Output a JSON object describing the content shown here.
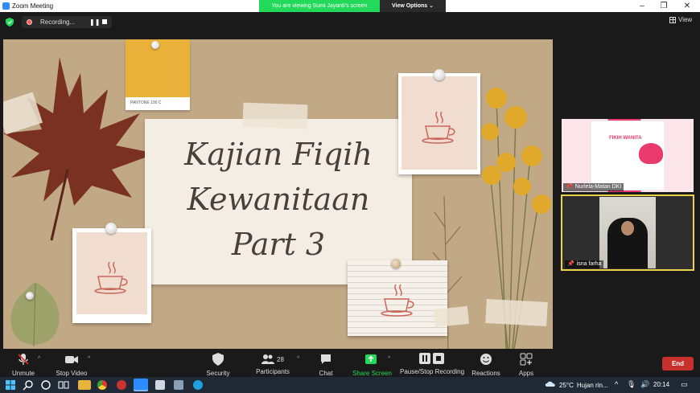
{
  "window": {
    "title": "Zoom Meeting"
  },
  "banner": {
    "message": "You are viewing Sumi Jayanti's screen",
    "options_label": "View Options"
  },
  "recording": {
    "label": "Recording..."
  },
  "view_button": {
    "label": "View"
  },
  "slide": {
    "title_line1": "Kajian Fiqih",
    "title_line2": "Kewanitaan",
    "title_line3": "Part 3",
    "pantone_label": "PANTONE 100 C"
  },
  "participants_tiles": [
    {
      "name": "Nurlela-Matan DKI",
      "poster_title": "FIKIH WANITA"
    },
    {
      "name": "isna farha"
    }
  ],
  "controls": {
    "unmute": "Unmute",
    "stop_video": "Stop Video",
    "security": "Security",
    "participants": "Participants",
    "participants_count": "28",
    "chat": "Chat",
    "share_screen": "Share Screen",
    "pause_stop_recording": "Pause/Stop Recording",
    "reactions": "Reactions",
    "apps": "Apps",
    "end": "End"
  },
  "taskbar": {
    "temperature": "25°C",
    "weather": "Hujan rin...",
    "time": "20:14"
  },
  "colors": {
    "share_green": "#23d959",
    "end_red": "#c8302e",
    "active_speaker_border": "#e8d34a",
    "zoom_blue": "#2d8cff"
  }
}
